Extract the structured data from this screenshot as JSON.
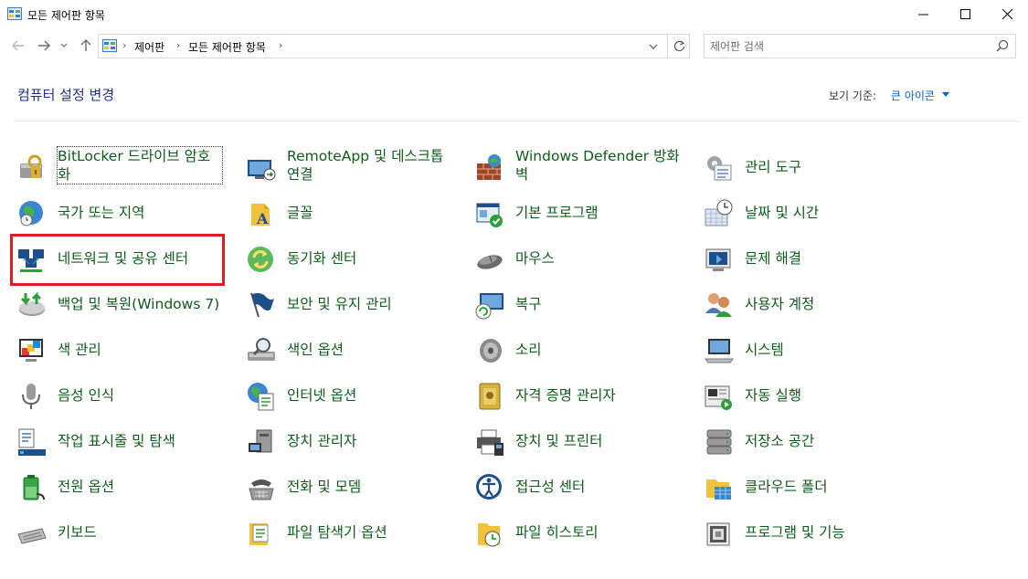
{
  "window": {
    "title": "모든 제어판 항목"
  },
  "address": {
    "crumbs": [
      "제어판",
      "모든 제어판 항목"
    ]
  },
  "search": {
    "placeholder": "제어판 검색"
  },
  "header": {
    "title": "컴퓨터 설정 변경",
    "view_by_label": "보기 기준:",
    "view_by_value": "큰 아이콘"
  },
  "items": [
    {
      "label": "BitLocker 드라이브 암호화",
      "icon": "bitlocker-icon"
    },
    {
      "label": "RemoteApp 및 데스크톱 연결",
      "icon": "remoteapp-icon"
    },
    {
      "label": "Windows Defender 방화벽",
      "icon": "firewall-icon"
    },
    {
      "label": "관리 도구",
      "icon": "admin-tools-icon"
    },
    {
      "label": "국가 또는 지역",
      "icon": "region-icon"
    },
    {
      "label": "글꼴",
      "icon": "fonts-icon"
    },
    {
      "label": "기본 프로그램",
      "icon": "default-programs-icon"
    },
    {
      "label": "날짜 및 시간",
      "icon": "date-time-icon"
    },
    {
      "label": "네트워크 및 공유 센터",
      "icon": "network-icon"
    },
    {
      "label": "동기화 센터",
      "icon": "sync-center-icon"
    },
    {
      "label": "마우스",
      "icon": "mouse-icon"
    },
    {
      "label": "문제 해결",
      "icon": "troubleshoot-icon"
    },
    {
      "label": "백업 및 복원(Windows 7)",
      "icon": "backup-icon"
    },
    {
      "label": "보안 및 유지 관리",
      "icon": "security-flag-icon"
    },
    {
      "label": "복구",
      "icon": "recovery-icon"
    },
    {
      "label": "사용자 계정",
      "icon": "user-accounts-icon"
    },
    {
      "label": "색 관리",
      "icon": "color-management-icon"
    },
    {
      "label": "색인 옵션",
      "icon": "indexing-icon"
    },
    {
      "label": "소리",
      "icon": "sound-icon"
    },
    {
      "label": "시스템",
      "icon": "system-icon"
    },
    {
      "label": "음성 인식",
      "icon": "microphone-icon"
    },
    {
      "label": "인터넷 옵션",
      "icon": "internet-options-icon"
    },
    {
      "label": "자격 증명 관리자",
      "icon": "credential-icon"
    },
    {
      "label": "자동 실행",
      "icon": "autoplay-icon"
    },
    {
      "label": "작업 표시줄 및 탐색",
      "icon": "taskbar-icon"
    },
    {
      "label": "장치 관리자",
      "icon": "device-manager-icon"
    },
    {
      "label": "장치 및 프린터",
      "icon": "printer-icon"
    },
    {
      "label": "저장소 공간",
      "icon": "storage-spaces-icon"
    },
    {
      "label": "전원 옵션",
      "icon": "power-icon"
    },
    {
      "label": "전화 및 모뎀",
      "icon": "phone-modem-icon"
    },
    {
      "label": "접근성 센터",
      "icon": "ease-of-access-icon"
    },
    {
      "label": "클라우드 폴더",
      "icon": "cloud-folder-icon"
    },
    {
      "label": "키보드",
      "icon": "keyboard-icon"
    },
    {
      "label": "파일 탐색기 옵션",
      "icon": "folder-options-icon"
    },
    {
      "label": "파일 히스토리",
      "icon": "file-history-icon"
    },
    {
      "label": "프로그램 및 기능",
      "icon": "programs-features-icon"
    }
  ],
  "colors": {
    "link_green": "#0d5c19",
    "heading_blue": "#1e3287",
    "accent_blue": "#0066cc",
    "highlight_red": "#e11b22"
  }
}
